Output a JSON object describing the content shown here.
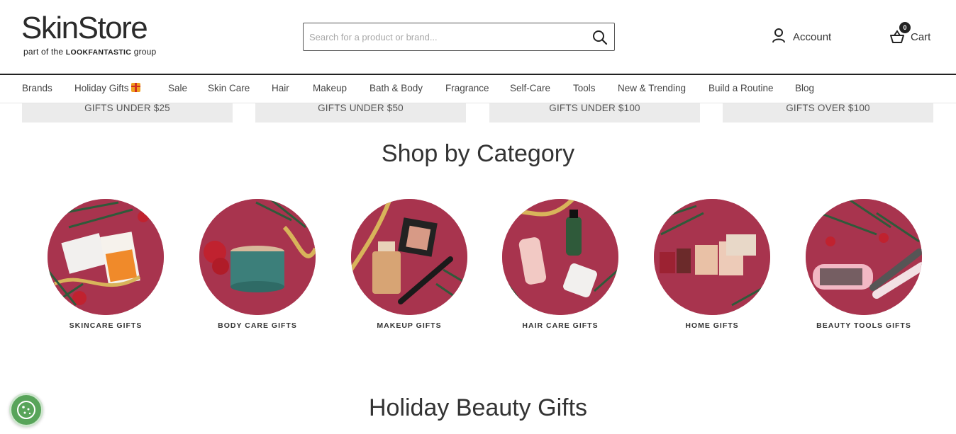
{
  "brand": {
    "name": "SkinStore",
    "tagline_prefix": "part of the",
    "tagline_brand": "LOOKFANTASTIC",
    "tagline_suffix": "group"
  },
  "search": {
    "placeholder": "Search for a product or brand...",
    "icon": "search-icon"
  },
  "header": {
    "account_label": "Account",
    "cart_label": "Cart",
    "cart_count": "0"
  },
  "nav": {
    "items": [
      {
        "label": "Brands"
      },
      {
        "label": "Holiday Gifts"
      },
      {
        "label": "Sale"
      },
      {
        "label": "Skin Care"
      },
      {
        "label": "Hair"
      },
      {
        "label": "Makeup"
      },
      {
        "label": "Bath & Body"
      },
      {
        "label": "Fragrance"
      },
      {
        "label": "Self-Care"
      },
      {
        "label": "Tools"
      },
      {
        "label": "New & Trending"
      },
      {
        "label": "Build a Routine"
      },
      {
        "label": "Blog"
      }
    ]
  },
  "price_tiles": [
    {
      "label": "GIFTS UNDER $25"
    },
    {
      "label": "GIFTS UNDER $50"
    },
    {
      "label": "GIFTS UNDER $100"
    },
    {
      "label": "GIFTS OVER $100"
    }
  ],
  "sections": {
    "category_title": "Shop by Category",
    "holiday_title": "Holiday Beauty Gifts"
  },
  "categories": [
    {
      "label": "SKINCARE GIFTS"
    },
    {
      "label": "BODY CARE GIFTS"
    },
    {
      "label": "MAKEUP GIFTS"
    },
    {
      "label": "HAIR CARE GIFTS"
    },
    {
      "label": "HOME GIFTS"
    },
    {
      "label": "BEAUTY TOOLS GIFTS"
    }
  ],
  "colors": {
    "accent_circle": "#a8344e",
    "cookie_button": "#58a45a"
  }
}
